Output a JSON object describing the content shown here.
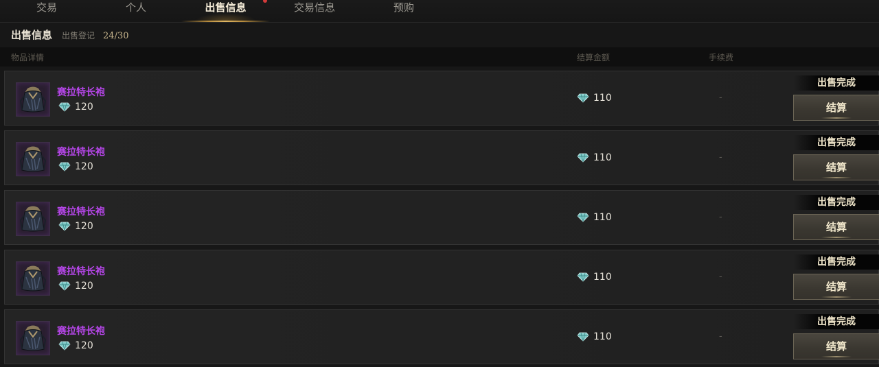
{
  "tabs": [
    {
      "label": "交易",
      "active": false
    },
    {
      "label": "个人",
      "active": false
    },
    {
      "label": "出售信息",
      "active": true
    },
    {
      "label": "交易信息",
      "active": false
    },
    {
      "label": "预购",
      "active": false
    }
  ],
  "subheader": {
    "title": "出售信息",
    "registration_label": "出售登记",
    "count": "24/30"
  },
  "columns": {
    "item_details": "物品详情",
    "settlement_amount": "结算金额",
    "fee": "手续费"
  },
  "rows": [
    {
      "item_name": "赛拉特长袍",
      "item_price": "120",
      "settlement": "110",
      "fee": "-",
      "status": "出售完成",
      "button": "结算"
    },
    {
      "item_name": "赛拉特长袍",
      "item_price": "120",
      "settlement": "110",
      "fee": "-",
      "status": "出售完成",
      "button": "结算"
    },
    {
      "item_name": "赛拉特长袍",
      "item_price": "120",
      "settlement": "110",
      "fee": "-",
      "status": "出售完成",
      "button": "结算"
    },
    {
      "item_name": "赛拉特长袍",
      "item_price": "120",
      "settlement": "110",
      "fee": "-",
      "status": "出售完成",
      "button": "结算"
    },
    {
      "item_name": "赛拉特长袍",
      "item_price": "120",
      "settlement": "110",
      "fee": "-",
      "status": "出售完成",
      "button": "结算"
    }
  ],
  "icons": {
    "currency": "diamond-icon",
    "item": "robe-icon"
  },
  "colors": {
    "item_name": "#b546e8",
    "active_tab_underline": "#e0b763"
  }
}
